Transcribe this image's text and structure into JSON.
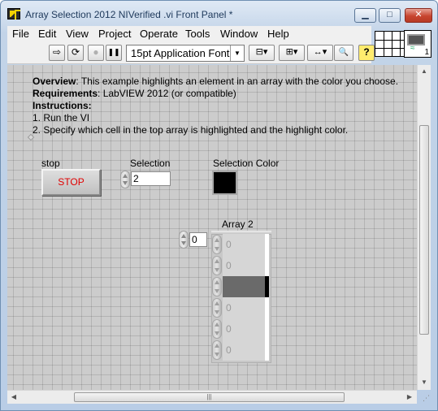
{
  "window": {
    "title": "Array Selection 2012 NIVerified .vi Front Panel *",
    "min_glyph": "▁",
    "max_glyph": "□",
    "close_glyph": "✕"
  },
  "menu": [
    "File",
    "Edit",
    "View",
    "Project",
    "Operate",
    "Tools",
    "Window",
    "Help"
  ],
  "toolbar": {
    "font_ring": "15pt Application Font",
    "icons": [
      "run-arrow-icon",
      "run-continuously-icon",
      "abort-icon",
      "pause-icon",
      "text-settings-icon",
      "align-objects-icon",
      "distribute-objects-icon",
      "resize-objects-icon",
      "reorder-icon",
      "search-icon",
      "context-help-icon"
    ],
    "glyphs": {
      "run": "⇨",
      "run_continuously": "⟳",
      "abort": "●",
      "pause": "❚❚",
      "dropdown": "▼",
      "align": "⊟▾",
      "distribute": "⊞▾",
      "resize": "↔▾",
      "reorder": "⇅▾",
      "search": "🔍",
      "help": "?"
    }
  },
  "connector_pane": {
    "icon_number": "1",
    "icon_glyph": "≈"
  },
  "description": {
    "overview_label": "Overview",
    "overview_text": ": This example highlights an element in an array with the color you choose.",
    "requirements_label": "Requirements",
    "requirements_text": ": LabVIEW 2012 (or compatible)",
    "instructions_label": "Instructions",
    "instructions_colon": ":",
    "step1": "1. Run the VI",
    "step2": "2. Specify which cell in the top array is highlighted and the highlight color."
  },
  "controls": {
    "stop_label": "stop",
    "stop_text": "STOP",
    "selection_label": "Selection",
    "selection_value": "2",
    "color_label": "Selection Color",
    "color_value": "#000000",
    "array_label": "Array 2",
    "array_index": "0",
    "array_values": [
      "0",
      "0",
      "",
      "0",
      "0",
      "0"
    ],
    "highlighted_index": 2
  },
  "scrollbars": {
    "up": "▲",
    "down": "▼",
    "left": "◀",
    "right": "▶",
    "grip": "|||",
    "resize": "⋰"
  }
}
